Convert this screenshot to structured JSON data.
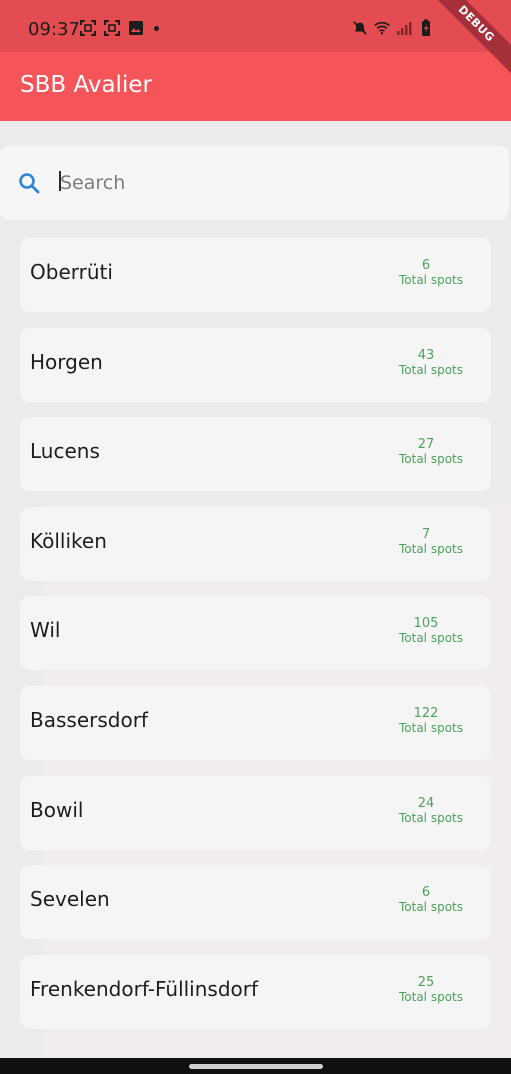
{
  "status_bar": {
    "time": "09:37",
    "icons_left": [
      "screenshot-icon",
      "screenshot-icon",
      "image-icon",
      "notification-dot-icon"
    ],
    "icons_right": [
      "mute-icon",
      "wifi-icon",
      "signal-icon",
      "battery-charging-icon"
    ]
  },
  "debug_banner": "DEBUG",
  "app_bar": {
    "title": "SBB Avalier",
    "color": "#f55459"
  },
  "search": {
    "placeholder": "Search",
    "value": ""
  },
  "stations": [
    {
      "name": "Oberrüti",
      "spots": "6",
      "spots_label": "Total spots"
    },
    {
      "name": "Horgen",
      "spots": "43",
      "spots_label": "Total spots"
    },
    {
      "name": "Lucens",
      "spots": "27",
      "spots_label": "Total spots"
    },
    {
      "name": "Kölliken",
      "spots": "7",
      "spots_label": "Total spots"
    },
    {
      "name": "Wil",
      "spots": "105",
      "spots_label": "Total spots"
    },
    {
      "name": "Bassersdorf",
      "spots": "122",
      "spots_label": "Total spots"
    },
    {
      "name": "Bowil",
      "spots": "24",
      "spots_label": "Total spots"
    },
    {
      "name": "Sevelen",
      "spots": "6",
      "spots_label": "Total spots"
    },
    {
      "name": "Frenkendorf-Füllinsdorf",
      "spots": "25",
      "spots_label": "Total spots"
    }
  ],
  "colors": {
    "accent": "#f55459",
    "spots": "#4ca35a",
    "search_icon": "#2f86d6"
  }
}
